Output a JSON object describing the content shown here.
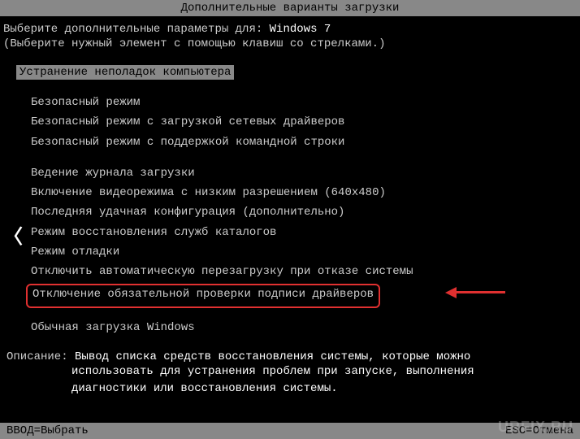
{
  "title": "Дополнительные варианты загрузки",
  "subtitle_prefix": "Выберите дополнительные параметры для: ",
  "os_name": "Windows 7",
  "instruction": "(Выберите нужный элемент с помощью клавиш со стрелками.)",
  "selected": "Устранение неполадок компьютера",
  "groups": [
    {
      "items": [
        "Безопасный режим",
        "Безопасный режим с загрузкой сетевых драйверов",
        "Безопасный режим с поддержкой командной строки"
      ]
    },
    {
      "items": [
        "Ведение журнала загрузки",
        "Включение видеорежима с низким разрешением (640x480)",
        "Последняя удачная конфигурация (дополнительно)",
        "Режим восстановления служб каталогов",
        "Режим отладки",
        "Отключить автоматическую перезагрузку при отказе системы"
      ]
    }
  ],
  "highlighted_item": "Отключение обязательной проверки подписи драйверов",
  "final_item": "Обычная загрузка Windows",
  "description": {
    "label": "Описание:",
    "line1": "Вывод списка средств восстановления системы, которые можно",
    "line2": "использовать для устранения проблем при запуске, выполнения",
    "line3": "диагностики или восстановления системы."
  },
  "footer": {
    "enter": "ВВОД=Выбрать",
    "esc": "ESC=Отмена"
  },
  "watermark": "URFIX.RU",
  "chevron": "〈"
}
